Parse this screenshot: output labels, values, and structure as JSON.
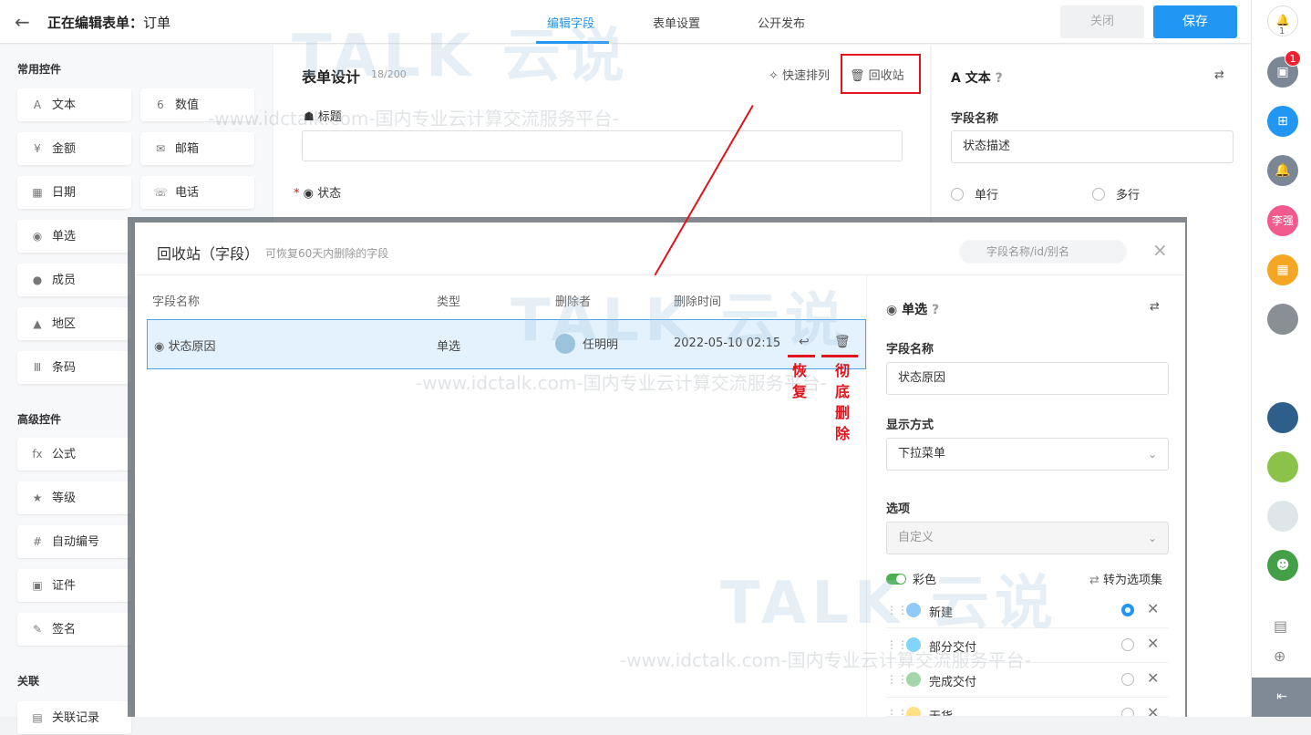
{
  "header": {
    "back": "←",
    "title_prefix": "正在编辑表单：",
    "title_name": "订单",
    "tabs": [
      "编辑字段",
      "表单设置",
      "公开发布"
    ],
    "close": "关闭",
    "save": "保存"
  },
  "left": {
    "sections": [
      {
        "title": "常用控件",
        "items": [
          {
            "icon": "A",
            "label": "文本"
          },
          {
            "icon": "6",
            "label": "数值"
          },
          {
            "icon": "¥",
            "label": "金额"
          },
          {
            "icon": "✉",
            "label": "邮箱"
          },
          {
            "icon": "▦",
            "label": "日期"
          },
          {
            "icon": "☏",
            "label": "电话"
          },
          {
            "icon": "◉",
            "label": "单选"
          },
          {
            "icon": "●",
            "label": "成员"
          },
          {
            "icon": "▲",
            "label": "地区"
          },
          {
            "icon": "Ⅲ",
            "label": "条码"
          }
        ]
      },
      {
        "title": "高级控件",
        "items": [
          {
            "icon": "fx",
            "label": "公式"
          },
          {
            "icon": "★",
            "label": "等级"
          },
          {
            "icon": "#",
            "label": "自动编号"
          },
          {
            "icon": "▣",
            "label": "证件"
          },
          {
            "icon": "✎",
            "label": "签名"
          }
        ]
      },
      {
        "title": "关联",
        "items": [
          {
            "icon": "▤",
            "label": "关联记录"
          }
        ]
      }
    ]
  },
  "center": {
    "title": "表单设计",
    "count": "18/200",
    "quick_sort": "快速排列",
    "recycle": "回收站",
    "field1_label": "标题",
    "field2_label": "状态"
  },
  "right": {
    "title": "文本",
    "field_name_label": "字段名称",
    "field_name_value": "状态描述",
    "radio1": "单行",
    "radio2": "多行"
  },
  "modal": {
    "title": "回收站（字段）",
    "subtitle": "可恢复60天内删除的字段",
    "search_placeholder": "字段名称/id/别名",
    "close": "×",
    "columns": [
      "字段名称",
      "类型",
      "删除者",
      "删除时间"
    ],
    "row": {
      "name": "状态原因",
      "type": "单选",
      "deleter": "任明明",
      "time": "2022-05-10 02:15"
    },
    "annotations": {
      "restore": "恢复",
      "delete": "彻底删除"
    },
    "panel": {
      "title": "单选",
      "field_name_label": "字段名称",
      "field_name_value": "状态原因",
      "display_label": "显示方式",
      "display_value": "下拉菜单",
      "options_label": "选项",
      "options_value": "自定义",
      "color_label": "彩色",
      "convert": "转为选项集",
      "options": [
        {
          "label": "新建",
          "color": "#90caf9",
          "selected": true
        },
        {
          "label": "部分交付",
          "color": "#81d4fa",
          "selected": false
        },
        {
          "label": "完成交付",
          "color": "#a5d6a7",
          "selected": false
        },
        {
          "label": "无货",
          "color": "#ffe082",
          "selected": false
        }
      ]
    }
  },
  "rail": {
    "badge": "1",
    "bell_count": "1",
    "user_name": "李强"
  },
  "watermark": {
    "big": "TALK 云说",
    "url": "-www.idctalk.com-国内专业云计算交流服务平台-"
  }
}
